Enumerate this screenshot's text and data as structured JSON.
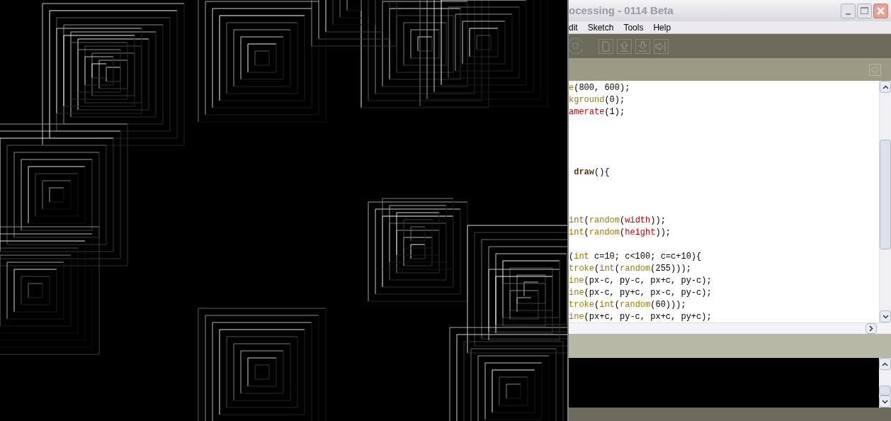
{
  "window": {
    "title": "ocessing - 0114 Beta"
  },
  "menu": [
    "dit",
    "Sketch",
    "Tools",
    "Help"
  ],
  "editor": {
    "lines": [
      {
        "kind": "code",
        "tokens": [
          {
            "text": "e",
            "kind": "function"
          },
          {
            "text": "(800, 600);",
            "kind": "plain"
          }
        ]
      },
      {
        "kind": "code",
        "tokens": [
          {
            "text": "kground",
            "kind": "function"
          },
          {
            "text": "(0);",
            "kind": "plain"
          }
        ]
      },
      {
        "kind": "code",
        "tokens": [
          {
            "text": "amerate",
            "kind": "literal"
          },
          {
            "text": "(1);",
            "kind": "plain"
          }
        ]
      },
      {
        "kind": "blank"
      },
      {
        "kind": "blank"
      },
      {
        "kind": "blank"
      },
      {
        "kind": "blank"
      },
      {
        "kind": "code",
        "tokens": [
          {
            "text": " draw",
            "kind": "bold"
          },
          {
            "text": "(){",
            "kind": "plain"
          }
        ]
      },
      {
        "kind": "blank"
      },
      {
        "kind": "blank"
      },
      {
        "kind": "blank"
      },
      {
        "kind": "code",
        "tokens": [
          {
            "text": "int",
            "kind": "keyword"
          },
          {
            "text": "(",
            "kind": "plain"
          },
          {
            "text": "random",
            "kind": "function"
          },
          {
            "text": "(",
            "kind": "plain"
          },
          {
            "text": "width",
            "kind": "literal"
          },
          {
            "text": "));",
            "kind": "plain"
          }
        ]
      },
      {
        "kind": "code",
        "tokens": [
          {
            "text": "int",
            "kind": "keyword"
          },
          {
            "text": "(",
            "kind": "plain"
          },
          {
            "text": "random",
            "kind": "function"
          },
          {
            "text": "(",
            "kind": "plain"
          },
          {
            "text": "height",
            "kind": "literal"
          },
          {
            "text": "));",
            "kind": "plain"
          }
        ]
      },
      {
        "kind": "blank"
      },
      {
        "kind": "code",
        "tokens": [
          {
            "text": "(",
            "kind": "plain"
          },
          {
            "text": "int",
            "kind": "keyword"
          },
          {
            "text": " c=10; c<100; c=c+10){",
            "kind": "plain"
          }
        ]
      },
      {
        "kind": "code",
        "tokens": [
          {
            "text": "troke",
            "kind": "function"
          },
          {
            "text": "(",
            "kind": "plain"
          },
          {
            "text": "int",
            "kind": "keyword"
          },
          {
            "text": "(",
            "kind": "plain"
          },
          {
            "text": "random",
            "kind": "function"
          },
          {
            "text": "(255)));",
            "kind": "plain"
          }
        ]
      },
      {
        "kind": "code",
        "tokens": [
          {
            "text": "ine",
            "kind": "function"
          },
          {
            "text": "(px-c, py-c, px+c, py-c);",
            "kind": "plain"
          }
        ]
      },
      {
        "kind": "code",
        "tokens": [
          {
            "text": "ine",
            "kind": "function"
          },
          {
            "text": "(px-c, py+c, px-c, py-c);",
            "kind": "plain"
          }
        ]
      },
      {
        "kind": "code",
        "tokens": [
          {
            "text": "troke",
            "kind": "function"
          },
          {
            "text": "(",
            "kind": "plain"
          },
          {
            "text": "int",
            "kind": "keyword"
          },
          {
            "text": "(",
            "kind": "plain"
          },
          {
            "text": "random",
            "kind": "function"
          },
          {
            "text": "(60)));",
            "kind": "plain"
          }
        ]
      },
      {
        "kind": "code",
        "tokens": [
          {
            "text": "ine",
            "kind": "function"
          },
          {
            "text": "(px+c, py-c, px+c, py+c);",
            "kind": "plain"
          }
        ]
      }
    ]
  }
}
